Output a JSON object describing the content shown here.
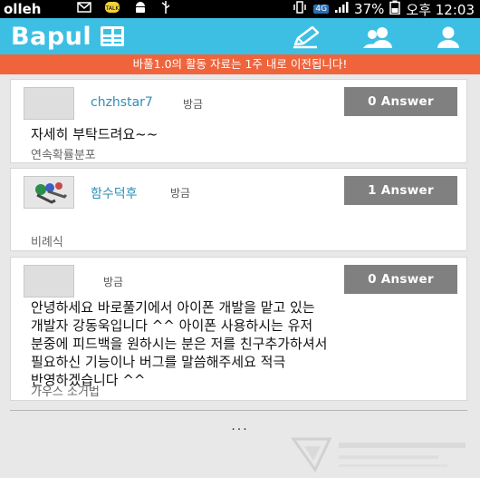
{
  "statusbar": {
    "carrier": "olleh",
    "network": "4G",
    "battery": "37%",
    "time": "오후 12:03"
  },
  "appbar": {
    "logo": "Bapul",
    "icons": [
      "grid-icon",
      "pencil-icon",
      "friends-icon",
      "profile-icon"
    ]
  },
  "banner": {
    "text": "바풀1.0의 활동 자료는 1주 내로 이전됩니다!"
  },
  "posts": [
    {
      "username": "chzhstar7",
      "time": "방금",
      "answer_label": "0 Answer",
      "question": "자세히 부탁드려요~~",
      "category": "연속확률분포"
    },
    {
      "username": "함수덕후",
      "time": "방금",
      "answer_label": "1 Answer",
      "question": "",
      "category": "비례식"
    },
    {
      "username": "",
      "time": "방금",
      "answer_label": "0 Answer",
      "question_lines": [
        "안녕하세요 바로풀기에서 아이폰 개발을 맡고 있는",
        "개발자 강동욱입니다 ^^ 아이폰 사용하시는 유저",
        "분중에 피드백을 원하시는 분은 저를 친구추가하셔서",
        "필요하신 기능이나 버그를 말씀해주세요 적극",
        "반영하겠습니다 ^^"
      ],
      "category": "가우스 소거법"
    }
  ],
  "more": "...",
  "colors": {
    "appbar": "#3dbfe4",
    "banner": "#f0643c",
    "answer_button": "#808080",
    "username": "#2d8fb5"
  }
}
